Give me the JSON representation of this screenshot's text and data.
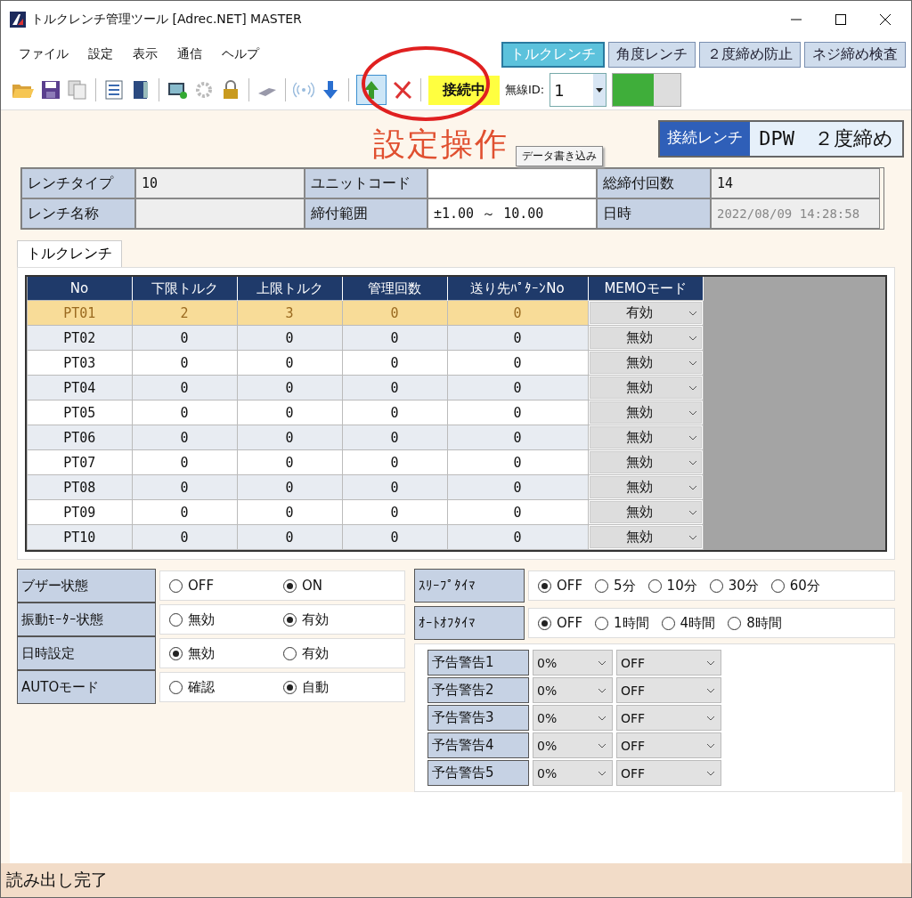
{
  "window": {
    "title": "トルクレンチ管理ツール [Adrec.NET] MASTER"
  },
  "menu": [
    "ファイル",
    "設定",
    "表示",
    "通信",
    "ヘルプ"
  ],
  "mode_tabs": [
    {
      "label": "トルクレンチ",
      "selected": true
    },
    {
      "label": "角度レンチ",
      "selected": false
    },
    {
      "label": "２度締め防止",
      "selected": false
    },
    {
      "label": "ネジ締め検査",
      "selected": false
    }
  ],
  "toolbar": {
    "connection_status": "接続中",
    "wireless_id_label": "無線ID:",
    "wireless_id": "1",
    "signal_meter": {
      "level": 0.6
    }
  },
  "heading": "設定操作",
  "tooltip": "データ書き込み",
  "connected_wrench": {
    "label": "接続レンチ",
    "value": "DPW　２度締め"
  },
  "info": [
    [
      {
        "label": "レンチタイプ",
        "value": "10"
      },
      {
        "label": "ユニットコード"
      },
      {
        "label": "総締付回数",
        "value": "14"
      }
    ],
    [
      {
        "label": "レンチ名称"
      },
      {
        "label": "締付範囲",
        "value": "±1.00 ～ 10.00"
      },
      {
        "label": "日時",
        "value": "2022/08/09 14:28:58"
      }
    ]
  ],
  "tab": "トルクレンチ",
  "table": {
    "columns": [
      "No",
      "下限トルク",
      "上限トルク",
      "管理回数",
      "送り先ﾊﾟﾀｰﾝNo",
      "MEMOモード"
    ],
    "rows": [
      {
        "cells": [
          "PT01",
          "2",
          "3",
          "0",
          "0"
        ],
        "memo": "有効",
        "selected": true
      },
      {
        "cells": [
          "PT02",
          "0",
          "0",
          "0",
          "0"
        ],
        "memo": "無効",
        "selected": false
      },
      {
        "cells": [
          "PT03",
          "0",
          "0",
          "0",
          "0"
        ],
        "memo": "無効",
        "selected": false
      },
      {
        "cells": [
          "PT04",
          "0",
          "0",
          "0",
          "0"
        ],
        "memo": "無効",
        "selected": false
      },
      {
        "cells": [
          "PT05",
          "0",
          "0",
          "0",
          "0"
        ],
        "memo": "無効",
        "selected": false
      },
      {
        "cells": [
          "PT06",
          "0",
          "0",
          "0",
          "0"
        ],
        "memo": "無効",
        "selected": false
      },
      {
        "cells": [
          "PT07",
          "0",
          "0",
          "0",
          "0"
        ],
        "memo": "無効",
        "selected": false
      },
      {
        "cells": [
          "PT08",
          "0",
          "0",
          "0",
          "0"
        ],
        "memo": "無効",
        "selected": false
      },
      {
        "cells": [
          "PT09",
          "0",
          "0",
          "0",
          "0"
        ],
        "memo": "無効",
        "selected": false
      },
      {
        "cells": [
          "PT10",
          "0",
          "0",
          "0",
          "0"
        ],
        "memo": "無効",
        "selected": false
      }
    ]
  },
  "device_settings": [
    {
      "label": "ブザー状態",
      "options": [
        {
          "label": "OFF",
          "selected": false
        },
        {
          "label": "ON",
          "selected": true
        }
      ]
    },
    {
      "label": "振動ﾓｰﾀｰ状態",
      "options": [
        {
          "label": "無効",
          "selected": false
        },
        {
          "label": "有効",
          "selected": true
        }
      ]
    },
    {
      "label": "日時設定",
      "options": [
        {
          "label": "無効",
          "selected": true
        },
        {
          "label": "有効",
          "selected": false
        }
      ]
    },
    {
      "label": "AUTOモード",
      "options": [
        {
          "label": "確認",
          "selected": false
        },
        {
          "label": "自動",
          "selected": true
        }
      ]
    }
  ],
  "timers": [
    {
      "label": "ｽﾘｰﾌﾟﾀｲﾏ",
      "options": [
        {
          "label": "OFF",
          "selected": true
        },
        {
          "label": "5分",
          "selected": false
        },
        {
          "label": "10分",
          "selected": false
        },
        {
          "label": "30分",
          "selected": false
        },
        {
          "label": "60分",
          "selected": false
        }
      ]
    },
    {
      "label": "ｵｰﾄｵﾌﾀｲﾏ",
      "options": [
        {
          "label": "OFF",
          "selected": true
        },
        {
          "label": "1時間",
          "selected": false
        },
        {
          "label": "4時間",
          "selected": false
        },
        {
          "label": "8時間",
          "selected": false
        }
      ]
    }
  ],
  "warnings": [
    {
      "label": "予告警告1",
      "percent": "0%",
      "mode": "OFF"
    },
    {
      "label": "予告警告2",
      "percent": "0%",
      "mode": "OFF"
    },
    {
      "label": "予告警告3",
      "percent": "0%",
      "mode": "OFF"
    },
    {
      "label": "予告警告4",
      "percent": "0%",
      "mode": "OFF"
    },
    {
      "label": "予告警告5",
      "percent": "0%",
      "mode": "OFF"
    }
  ],
  "status_bar": "読み出し完了"
}
